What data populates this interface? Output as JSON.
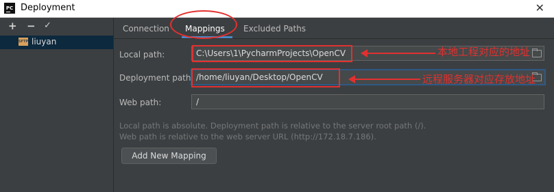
{
  "window": {
    "title": "Deployment",
    "app_icon": "PC",
    "close_glyph": "✕"
  },
  "toolbar": {
    "add": "+",
    "remove": "−",
    "apply": "✓"
  },
  "servers": [
    {
      "name": "liuyan",
      "type_icon": "SFTP"
    }
  ],
  "tabs": [
    {
      "label": "Connection",
      "selected": false
    },
    {
      "label": "Mappings",
      "selected": true
    },
    {
      "label": "Excluded Paths",
      "selected": false
    }
  ],
  "mapping": {
    "local_path": {
      "label": "Local path:",
      "value": "C:\\Users\\1\\PycharmProjects\\OpenCV"
    },
    "deployment_path": {
      "label": "Deployment path:",
      "value": "/home/liuyan/Desktop/OpenCV"
    },
    "web_path": {
      "label": "Web path:",
      "value": "/"
    }
  },
  "info": {
    "line1": "Local path is absolute. Deployment path is relative to the server root path (/).",
    "line2": "Web path is relative to the web server URL (http://172.18.7.186)."
  },
  "add_mapping_button": "Add New Mapping",
  "annotations": {
    "local": "本地工程对应的地址",
    "remote": "远程服务器对应存放地址"
  },
  "colors": {
    "background": "#3c3f41",
    "annotation_red": "#e3302f",
    "selected_row": "#0d293e",
    "focus_border": "#2e5a87"
  }
}
